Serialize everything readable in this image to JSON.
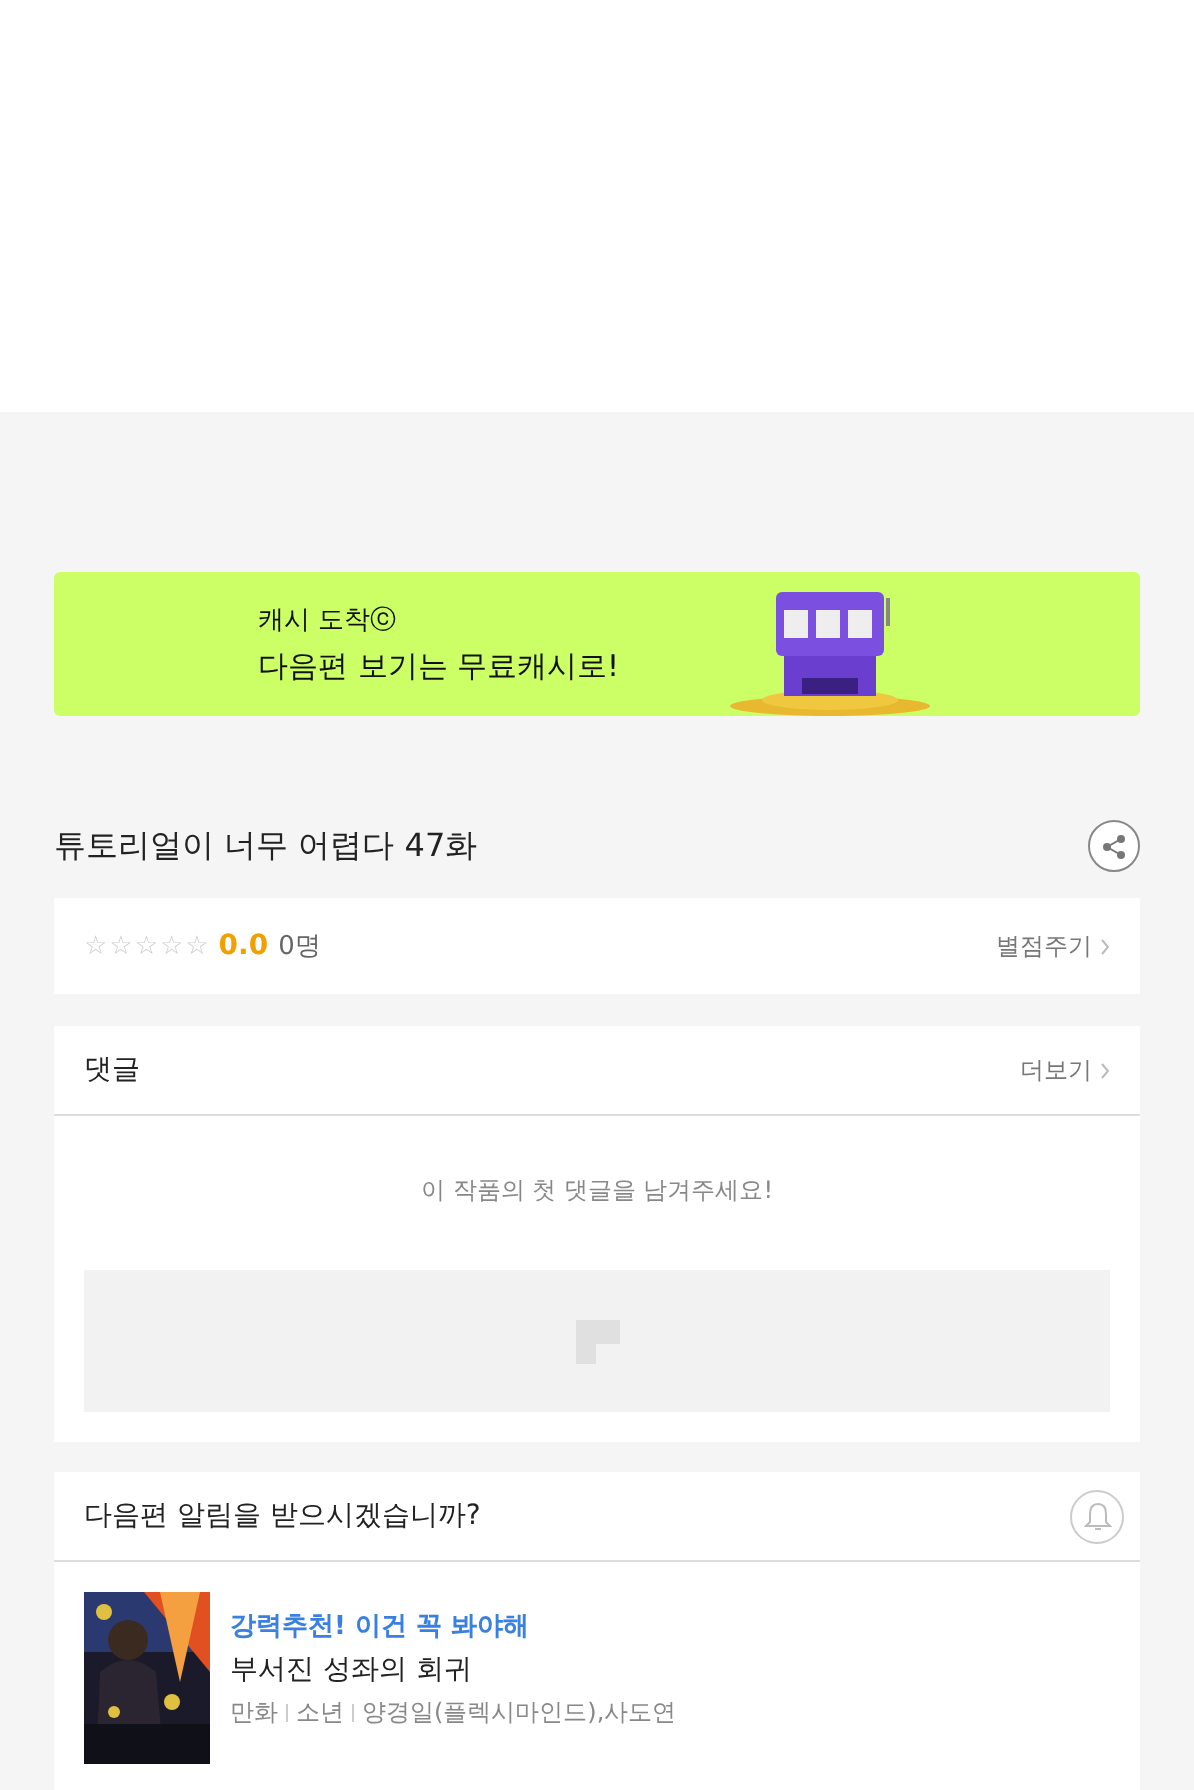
{
  "banner": {
    "title": "캐시 도착ⓒ",
    "subtitle": "다음편 보기는 무료캐시로!"
  },
  "episode": {
    "title": "튜토리얼이 너무 어렵다 47화"
  },
  "rating": {
    "stars": 0,
    "score": "0.0",
    "count": "0명",
    "action": "별점주기"
  },
  "comments": {
    "title": "댓글",
    "more": "더보기",
    "empty": "이 작품의 첫 댓글을 남겨주세요!"
  },
  "alert": {
    "question": "다음편 알림을 받으시겠습니까?",
    "subscribed": false
  },
  "recommendations": [
    {
      "kind": "picture",
      "tag": "강력추천! 이건 꼭 봐야해",
      "title": "부서진 성좌의 회귀",
      "meta": [
        "만화",
        "소년",
        "양경일(플렉시마인드),사도연"
      ]
    }
  ]
}
